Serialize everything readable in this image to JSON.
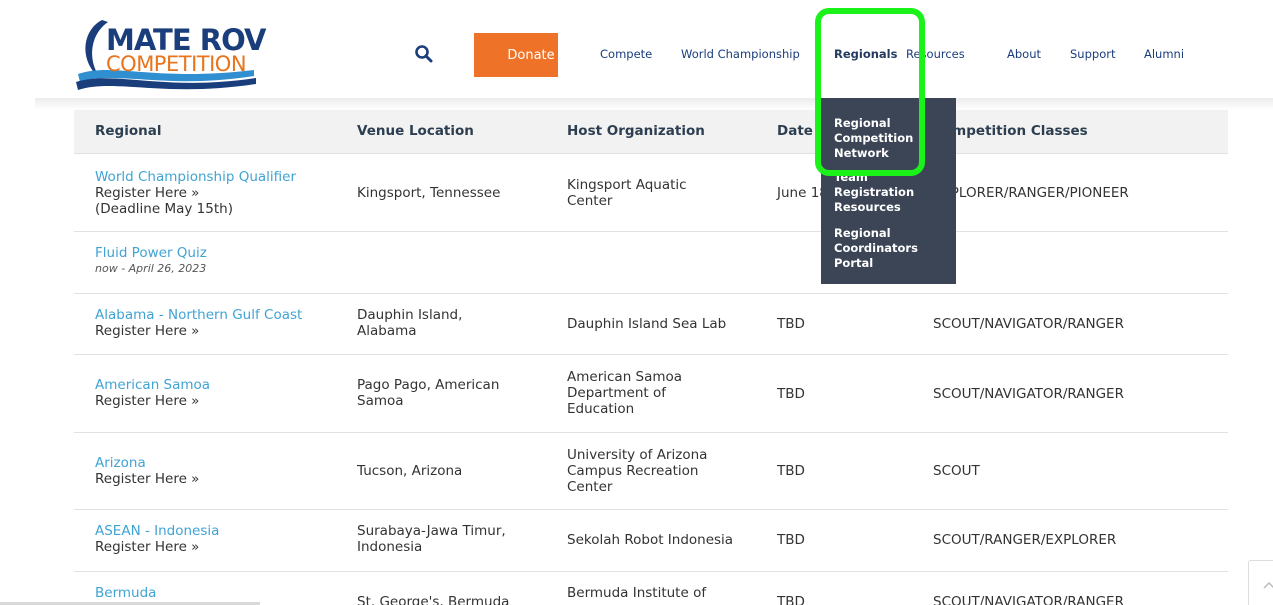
{
  "header": {
    "logo": {
      "line1": "MATE ROV",
      "line2": "COMPETITION"
    },
    "donate_label": "Donate",
    "nav": [
      "Compete",
      "World Championship",
      "Regionals",
      "Resources",
      "About",
      "Support",
      "Alumni"
    ]
  },
  "dropdown": {
    "items": [
      "Regional Competition Network",
      "Team Registration Resources",
      "Regional Coordinators Portal"
    ]
  },
  "table": {
    "headers": [
      "Regional",
      "Venue Location",
      "Host Organization",
      "Date",
      "Competition Classes"
    ],
    "rows": [
      {
        "regional": "World Championship Qualifier",
        "register": "Register Here »",
        "note": "(Deadline May 15th)",
        "venue": "Kingsport, Tennessee",
        "host": "Kingsport Aquatic Center",
        "date": "June 18",
        "classes": "EXPLORER/RANGER/PIONEER"
      },
      {
        "regional": "Fluid Power Quiz",
        "register": "now - April 26, 2023",
        "note": "",
        "venue": "",
        "host": "",
        "date": "",
        "classes": ""
      },
      {
        "regional": "Alabama - Northern Gulf Coast",
        "register": "Register Here »",
        "note": "",
        "venue": "Dauphin Island, Alabama",
        "host": "Dauphin Island Sea Lab",
        "date": "TBD",
        "classes": "SCOUT/NAVIGATOR/RANGER"
      },
      {
        "regional": "American Samoa",
        "register": "Register Here »",
        "note": "",
        "venue": "Pago Pago, American Samoa",
        "host": "American Samoa Department of Education",
        "date": "TBD",
        "classes": "SCOUT/NAVIGATOR/RANGER"
      },
      {
        "regional": "Arizona",
        "register": "Register Here »",
        "note": "",
        "venue": "Tucson, Arizona",
        "host": "University of Arizona Campus Recreation Center",
        "date": "TBD",
        "classes": "SCOUT"
      },
      {
        "regional": "ASEAN - Indonesia",
        "register": "Register Here »",
        "note": "",
        "venue": "Surabaya-Jawa Timur, Indonesia",
        "host": "Sekolah Robot Indonesia",
        "date": "TBD",
        "classes": "SCOUT/RANGER/EXPLORER"
      },
      {
        "regional": "Bermuda",
        "register": "",
        "note": "",
        "venue": "St. George's, Bermuda",
        "host": "Bermuda Institute of",
        "date": "TBD",
        "classes": "SCOUT/NAVIGATOR/RANGER"
      }
    ]
  },
  "colors": {
    "accent": "#ee7328",
    "link": "#41a3d4",
    "navy": "#1a3d7c",
    "dropdown_bg": "#3c4556",
    "highlight": "#1af21a"
  }
}
